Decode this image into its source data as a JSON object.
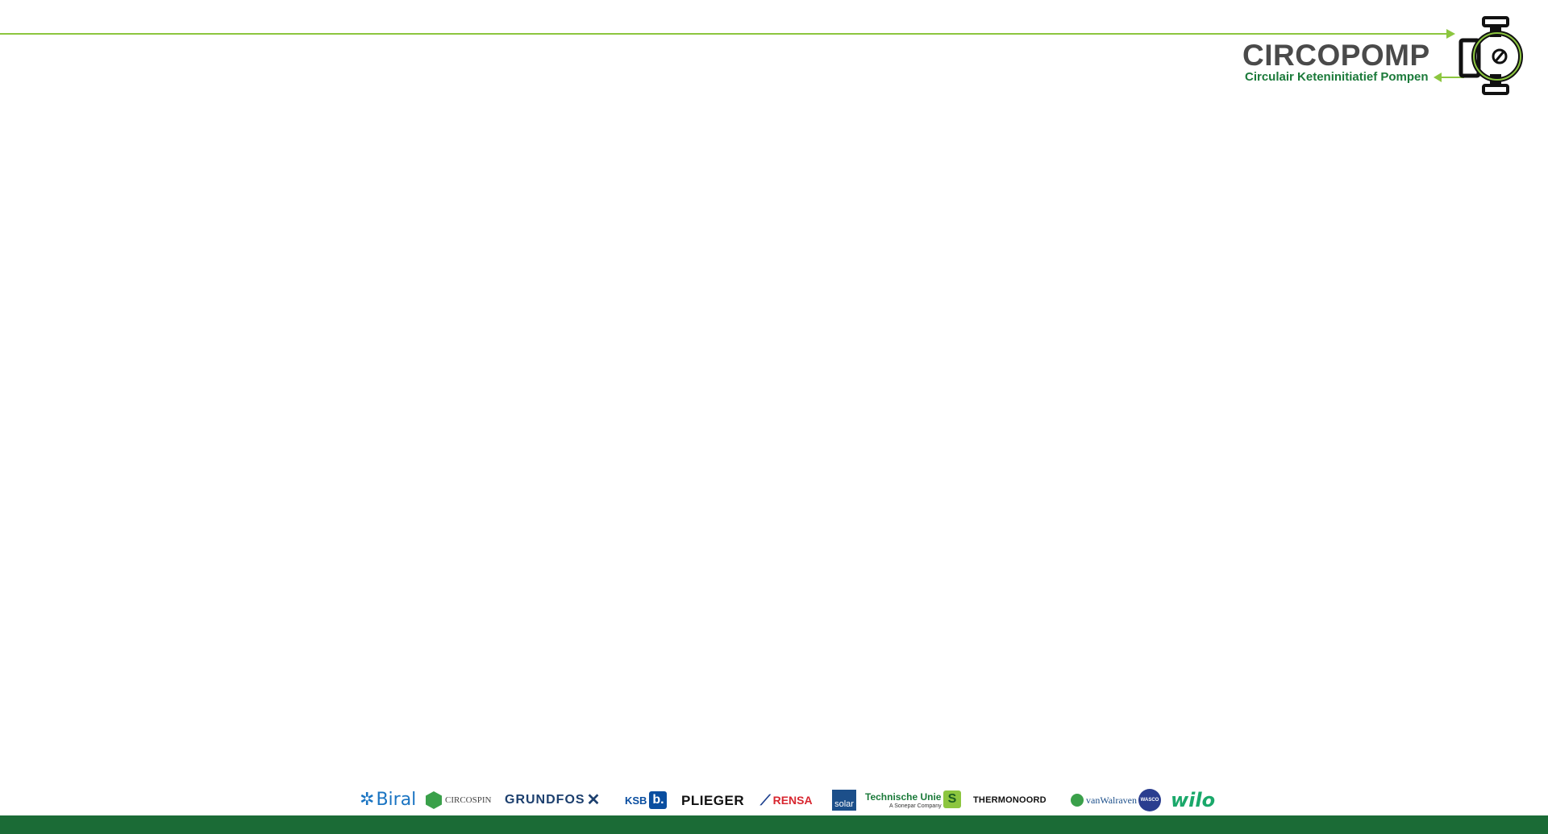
{
  "header": {
    "logo_title": "CIRCOPOMP",
    "logo_subtitle": "Circulair Keteninitiatief Pompen",
    "logo_icon": "pump-icon"
  },
  "partners": {
    "biral": "Biral",
    "circospin": "CIRCOSPIN",
    "grundfos": "GRUNDFOS",
    "ksb": "KSB",
    "ksb_mark": "b.",
    "plieger": "PLIEGER",
    "rensa": "RENSA",
    "solar": "solar",
    "technische_unie": "Technische Unie",
    "technische_unie_sub": "A Sonepar Company",
    "thermonoord": "THERMONOORD",
    "vanwalraven": "vanWalraven",
    "wasco": "WASCO",
    "wilo": "wilo"
  },
  "colors": {
    "accent_green": "#8cc63f",
    "dark_green": "#1b6b36",
    "logo_grey": "#4a4a4a"
  }
}
